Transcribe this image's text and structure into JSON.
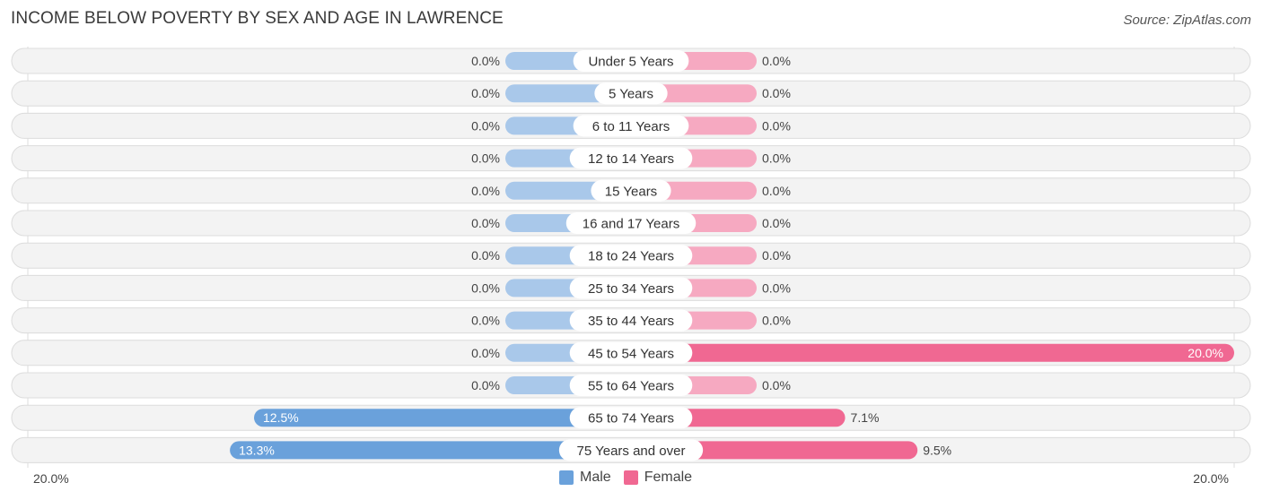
{
  "title": "INCOME BELOW POVERTY BY SEX AND AGE IN LAWRENCE",
  "source": "Source: ZipAtlas.com",
  "colors": {
    "male_strong": "#6aa1db",
    "male_light": "#a9c8ea",
    "female_strong": "#f06892",
    "female_light": "#f6a9c1",
    "row_bg": "#f3f3f3",
    "row_border": "#dcdcdc"
  },
  "chart_data": {
    "type": "bar",
    "orientation": "horizontal-diverging",
    "title": "INCOME BELOW POVERTY BY SEX AND AGE IN LAWRENCE",
    "categories": [
      "Under 5 Years",
      "5 Years",
      "6 to 11 Years",
      "12 to 14 Years",
      "15 Years",
      "16 and 17 Years",
      "18 to 24 Years",
      "25 to 34 Years",
      "35 to 44 Years",
      "45 to 54 Years",
      "55 to 64 Years",
      "65 to 74 Years",
      "75 Years and over"
    ],
    "series": [
      {
        "name": "Male",
        "values": [
          0.0,
          0.0,
          0.0,
          0.0,
          0.0,
          0.0,
          0.0,
          0.0,
          0.0,
          0.0,
          0.0,
          12.5,
          13.3
        ],
        "labels": [
          "0.0%",
          "0.0%",
          "0.0%",
          "0.0%",
          "0.0%",
          "0.0%",
          "0.0%",
          "0.0%",
          "0.0%",
          "0.0%",
          "0.0%",
          "12.5%",
          "13.3%"
        ]
      },
      {
        "name": "Female",
        "values": [
          0.0,
          0.0,
          0.0,
          0.0,
          0.0,
          0.0,
          0.0,
          0.0,
          0.0,
          20.0,
          0.0,
          7.1,
          9.5
        ],
        "labels": [
          "0.0%",
          "0.0%",
          "0.0%",
          "0.0%",
          "0.0%",
          "0.0%",
          "0.0%",
          "0.0%",
          "0.0%",
          "20.0%",
          "0.0%",
          "7.1%",
          "9.5%"
        ]
      }
    ],
    "xlim": [
      0,
      20
    ],
    "axis_labels": {
      "left": "20.0%",
      "right": "20.0%"
    },
    "legend": {
      "position": "bottom-center",
      "entries": [
        "Male",
        "Female"
      ]
    },
    "grid": false
  }
}
